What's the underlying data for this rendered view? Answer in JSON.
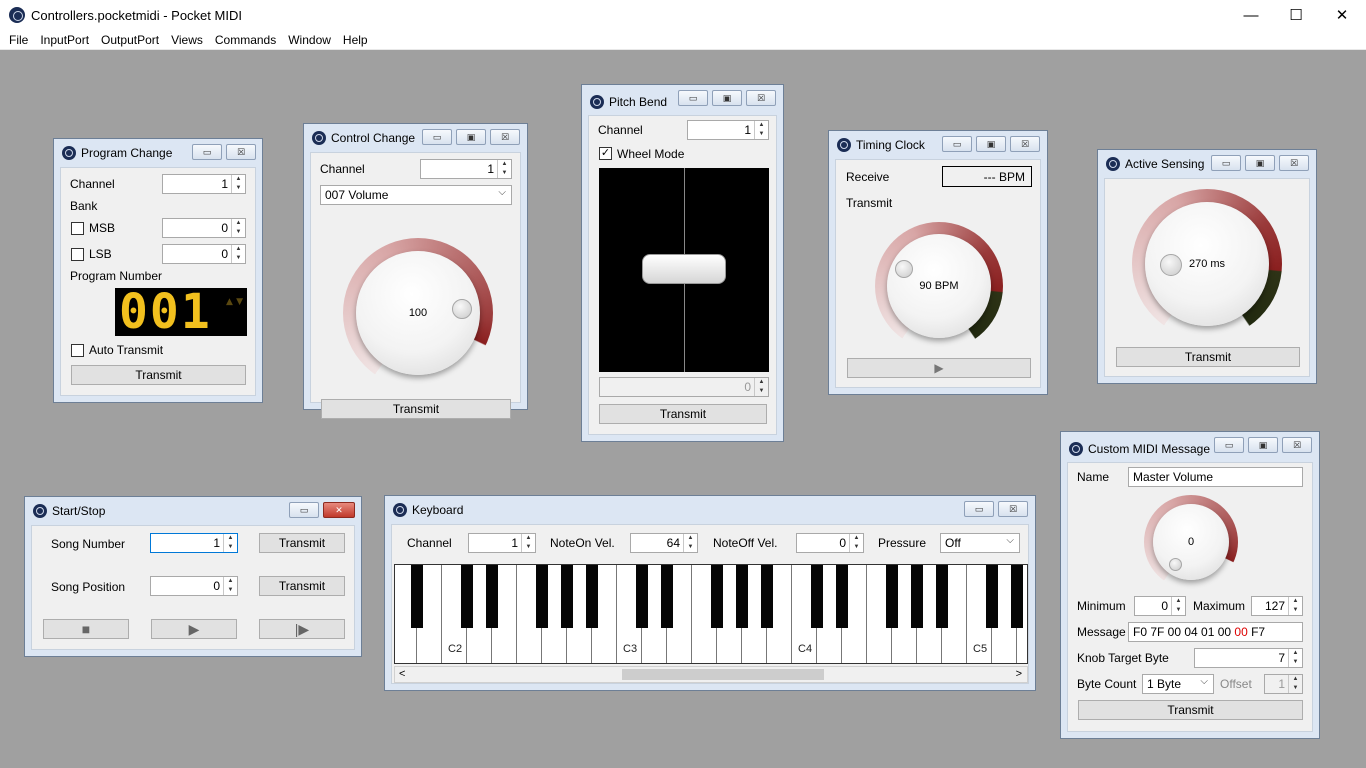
{
  "app": {
    "title": "Controllers.pocketmidi - Pocket MIDI"
  },
  "menu": [
    "File",
    "InputPort",
    "OutputPort",
    "Views",
    "Commands",
    "Window",
    "Help"
  ],
  "win_glyphs": {
    "min": "—",
    "max": "☐",
    "close": "✕",
    "wmin": "▭",
    "wmax": "▣",
    "wclose": "☒"
  },
  "program_change": {
    "title": "Program Change",
    "channel_label": "Channel",
    "channel": "1",
    "bank_label": "Bank",
    "msb_label": "MSB",
    "msb": "0",
    "lsb_label": "LSB",
    "lsb": "0",
    "program_label": "Program Number",
    "digits": [
      "0",
      "0",
      "1"
    ],
    "auto_label": "Auto Transmit",
    "transmit": "Transmit"
  },
  "control_change": {
    "title": "Control Change",
    "channel_label": "Channel",
    "channel": "1",
    "controller": "007 Volume",
    "knob_value": "100",
    "transmit": "Transmit"
  },
  "pitch_bend": {
    "title": "Pitch Bend",
    "channel_label": "Channel",
    "channel": "1",
    "wheel_label": "Wheel Mode",
    "wheel_checked": "✓",
    "value": "0",
    "transmit": "Transmit"
  },
  "timing_clock": {
    "title": "Timing Clock",
    "receive_label": "Receive",
    "receive_value": "--- BPM",
    "transmit_label": "Transmit",
    "knob_value": "90 BPM",
    "play_glyph": "▶"
  },
  "active_sensing": {
    "title": "Active Sensing",
    "knob_value": "270 ms",
    "transmit": "Transmit"
  },
  "start_stop": {
    "title": "Start/Stop",
    "song_number_label": "Song Number",
    "song_number": "1",
    "song_position_label": "Song Position",
    "song_position": "0",
    "transmit1": "Transmit",
    "transmit2": "Transmit",
    "stop_glyph": "■",
    "play_glyph": "▶",
    "continue_glyph": "|▶"
  },
  "keyboard": {
    "title": "Keyboard",
    "channel_label": "Channel",
    "channel": "1",
    "noteon_label": "NoteOn Vel.",
    "noteon": "64",
    "noteoff_label": "NoteOff Vel.",
    "noteoff": "0",
    "pressure_label": "Pressure",
    "pressure": "Off",
    "notes": [
      "C2",
      "C3",
      "C4",
      "C5"
    ],
    "scroll_left": "<",
    "scroll_right": ">"
  },
  "custom_midi": {
    "title": "Custom MIDI Message",
    "name_label": "Name",
    "name": "Master Volume",
    "knob_value": "0",
    "min_label": "Minimum",
    "min": "0",
    "max_label": "Maximum",
    "max": "127",
    "message_label": "Message",
    "message_prefix": "F0 7F 00 04 01 00 ",
    "message_hl": "00",
    "message_suffix": " F7",
    "target_label": "Knob Target Byte",
    "target": "7",
    "bytecount_label": "Byte Count",
    "bytecount": "1 Byte",
    "offset_label": "Offset",
    "offset": "1",
    "transmit": "Transmit"
  },
  "spin_arrows": "▲\n▼",
  "chevron": "⌵"
}
